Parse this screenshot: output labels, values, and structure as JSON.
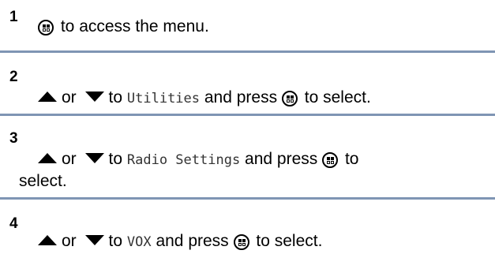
{
  "steps": [
    {
      "number": "1",
      "text": "to access the menu."
    },
    {
      "number": "2",
      "or": "or",
      "to": "to",
      "menu_item": "Utilities",
      "press": "and press",
      "after": "to select."
    },
    {
      "number": "3",
      "or": "or",
      "to": "to",
      "menu_item": "Radio Settings",
      "press": "and press",
      "after": "to",
      "after2": "select."
    },
    {
      "number": "4",
      "or": "or",
      "to": "to",
      "menu_item": "VOX",
      "press": "and press",
      "after": "to select."
    }
  ],
  "icons": {
    "menu_ok_button": "menu-ok-button-icon",
    "up_arrow": "up-arrow-icon",
    "down_arrow": "down-arrow-icon"
  },
  "colors": {
    "separator": "#7f95b4"
  }
}
